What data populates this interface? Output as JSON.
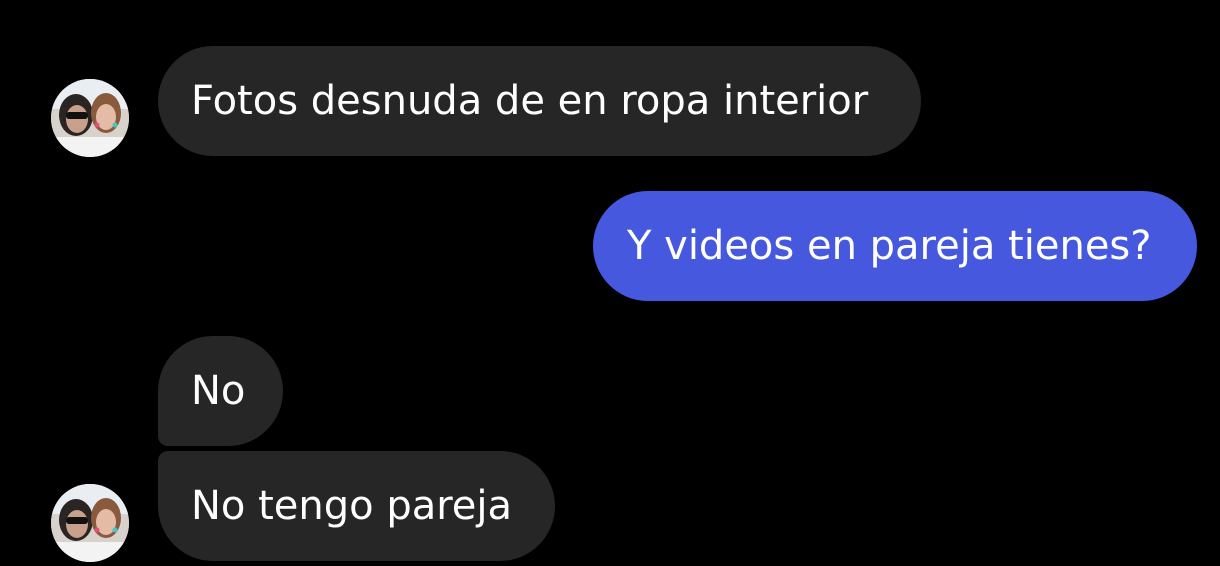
{
  "chat": {
    "messages": [
      {
        "direction": "incoming",
        "text": "Fotos desnuda de en ropa interior",
        "show_avatar": true
      },
      {
        "direction": "outgoing",
        "text": "Y videos en pareja tienes?"
      },
      {
        "direction": "incoming",
        "text": "No",
        "show_avatar": false
      },
      {
        "direction": "incoming",
        "text": "No tengo pareja",
        "show_avatar": true
      }
    ],
    "avatar_icon": "profile-photo-two-people",
    "colors": {
      "background": "#000000",
      "incoming_bubble": "#262626",
      "outgoing_bubble": "#4658dd",
      "text": "#ffffff"
    }
  }
}
